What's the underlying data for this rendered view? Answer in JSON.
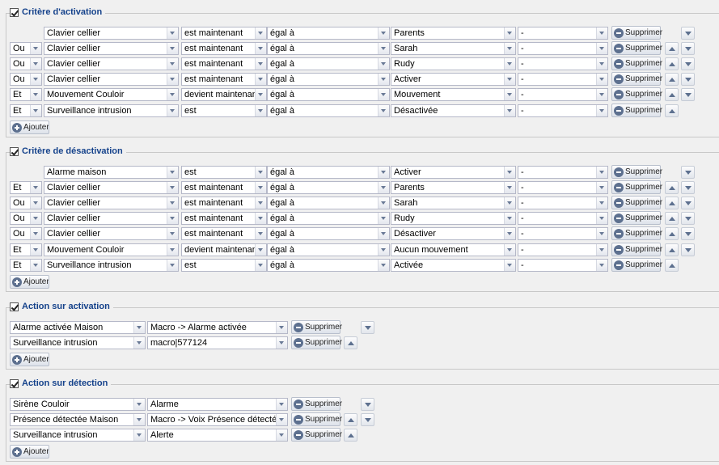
{
  "labels": {
    "delete": "Supprimer",
    "add": "Ajouter"
  },
  "sections": [
    {
      "key": "critere-activation",
      "title": "Critère d'activation",
      "kind": "criteria",
      "rows": [
        {
          "op": "",
          "device": "Clavier cellier",
          "state": "est maintenant",
          "cmp": "égal à",
          "value": "Parents",
          "extra": "-",
          "up": false,
          "down": true
        },
        {
          "op": "Ou",
          "device": "Clavier cellier",
          "state": "est maintenant",
          "cmp": "égal à",
          "value": "Sarah",
          "extra": "-",
          "up": true,
          "down": true
        },
        {
          "op": "Ou",
          "device": "Clavier cellier",
          "state": "est maintenant",
          "cmp": "égal à",
          "value": "Rudy",
          "extra": "-",
          "up": true,
          "down": true
        },
        {
          "op": "Ou",
          "device": "Clavier cellier",
          "state": "est maintenant",
          "cmp": "égal à",
          "value": "Activer",
          "extra": "-",
          "up": true,
          "down": true
        },
        {
          "op": "Et",
          "device": "Mouvement Couloir",
          "state": "devient maintenant",
          "cmp": "égal à",
          "value": "Mouvement",
          "extra": "-",
          "up": true,
          "down": true
        },
        {
          "op": "Et",
          "device": "Surveillance intrusion",
          "state": "est",
          "cmp": "égal à",
          "value": "Désactivée",
          "extra": "-",
          "up": true,
          "down": false
        }
      ]
    },
    {
      "key": "critere-desactivation",
      "title": "Critère de désactivation",
      "kind": "criteria",
      "rows": [
        {
          "op": "",
          "device": "Alarme maison",
          "state": "est",
          "cmp": "égal à",
          "value": "Activer",
          "extra": "-",
          "up": false,
          "down": true
        },
        {
          "op": "Et",
          "device": "Clavier cellier",
          "state": "est maintenant",
          "cmp": "égal à",
          "value": "Parents",
          "extra": "-",
          "up": true,
          "down": true
        },
        {
          "op": "Ou",
          "device": "Clavier cellier",
          "state": "est maintenant",
          "cmp": "égal à",
          "value": "Sarah",
          "extra": "-",
          "up": true,
          "down": true
        },
        {
          "op": "Ou",
          "device": "Clavier cellier",
          "state": "est maintenant",
          "cmp": "égal à",
          "value": "Rudy",
          "extra": "-",
          "up": true,
          "down": true
        },
        {
          "op": "Ou",
          "device": "Clavier cellier",
          "state": "est maintenant",
          "cmp": "égal à",
          "value": "Désactiver",
          "extra": "-",
          "up": true,
          "down": true
        },
        {
          "op": "Et",
          "device": "Mouvement Couloir",
          "state": "devient maintenant",
          "cmp": "égal à",
          "value": "Aucun mouvement",
          "extra": "-",
          "up": true,
          "down": true
        },
        {
          "op": "Et",
          "device": "Surveillance intrusion",
          "state": "est",
          "cmp": "égal à",
          "value": "Activée",
          "extra": "-",
          "up": true,
          "down": false
        }
      ]
    },
    {
      "key": "action-activation",
      "title": "Action sur activation",
      "kind": "action",
      "rows": [
        {
          "device": "Alarme activée Maison",
          "action": "Macro -> Alarme activée",
          "up": false,
          "down": true
        },
        {
          "device": "Surveillance intrusion",
          "action": "macro|577124",
          "up": true,
          "down": false
        }
      ]
    },
    {
      "key": "action-detection",
      "title": "Action sur détection",
      "kind": "action",
      "rows": [
        {
          "device": "Sirène Couloir",
          "action": "Alarme",
          "up": false,
          "down": true
        },
        {
          "device": "Présence détectée Maison",
          "action": "Macro -> Voix Présence détectée",
          "up": true,
          "down": true
        },
        {
          "device": "Surveillance intrusion",
          "action": "Alerte",
          "up": true,
          "down": false
        }
      ]
    }
  ]
}
